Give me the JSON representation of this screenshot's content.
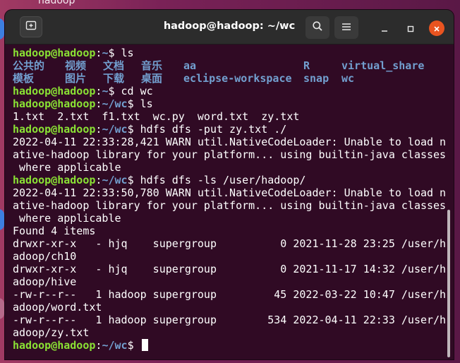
{
  "desktop": {
    "label": "hadoop"
  },
  "window": {
    "title": "hadoop@hadoop: ~/wc",
    "icons": {
      "new_tab": "new-tab-icon",
      "search": "search-icon",
      "menu": "hamburger-menu-icon",
      "minimize": "minimize-icon",
      "maximize": "maximize-icon",
      "close": "close-icon"
    },
    "accent": "#e95420"
  },
  "terminal": {
    "colors": {
      "bg": "#300a24",
      "user": "#8ae234",
      "path": "#729fcf",
      "text": "#ffffff"
    },
    "prompt_user": "hadoop@hadoop",
    "prompt_colon": ":",
    "path_home": "~",
    "path_wc": "~/wc",
    "prompt_end": "$ ",
    "lines": [
      {
        "type": "prompt",
        "path": "~",
        "cmd": "ls"
      },
      {
        "type": "dirs",
        "items": [
          "公共的",
          "视频",
          "文档",
          "音乐",
          "aa",
          "R",
          "virtual_share"
        ]
      },
      {
        "type": "dirs",
        "items": [
          "模板",
          "图片",
          "下载",
          "桌面",
          "eclipse-workspace",
          "snap",
          "wc"
        ]
      },
      {
        "type": "prompt",
        "path": "~",
        "cmd": "cd wc"
      },
      {
        "type": "prompt",
        "path": "~/wc",
        "cmd": "ls"
      },
      {
        "type": "text",
        "text": "1.txt  2.txt  f1.txt  wc.py  word.txt  zy.txt"
      },
      {
        "type": "prompt",
        "path": "~/wc",
        "cmd": "hdfs dfs -put zy.txt ./"
      },
      {
        "type": "text",
        "text": "2022-04-11 22:33:28,421 WARN util.NativeCodeLoader: Unable to load n"
      },
      {
        "type": "text",
        "text": "ative-hadoop library for your platform... using builtin-java classes"
      },
      {
        "type": "text",
        "text": " where applicable"
      },
      {
        "type": "prompt",
        "path": "~/wc",
        "cmd": "hdfs dfs -ls /user/hadoop/"
      },
      {
        "type": "text",
        "text": "2022-04-11 22:33:50,780 WARN util.NativeCodeLoader: Unable to load n"
      },
      {
        "type": "text",
        "text": "ative-hadoop library for your platform... using builtin-java classes"
      },
      {
        "type": "text",
        "text": " where applicable"
      },
      {
        "type": "text",
        "text": "Found 4 items"
      },
      {
        "type": "text",
        "text": "drwxr-xr-x   - hjq    supergroup          0 2021-11-28 23:25 /user/h"
      },
      {
        "type": "text",
        "text": "adoop/ch10"
      },
      {
        "type": "text",
        "text": "drwxr-xr-x   - hjq    supergroup          0 2021-11-17 14:32 /user/h"
      },
      {
        "type": "text",
        "text": "adoop/hive"
      },
      {
        "type": "text",
        "text": "-rw-r--r--   1 hadoop supergroup         45 2022-03-22 10:47 /user/h"
      },
      {
        "type": "text",
        "text": "adoop/word.txt"
      },
      {
        "type": "text",
        "text": "-rw-r--r--   1 hadoop supergroup        534 2022-04-11 22:33 /user/h"
      },
      {
        "type": "text",
        "text": "adoop/zy.txt"
      },
      {
        "type": "prompt",
        "path": "~/wc",
        "cmd": "",
        "cursor": true
      }
    ]
  }
}
